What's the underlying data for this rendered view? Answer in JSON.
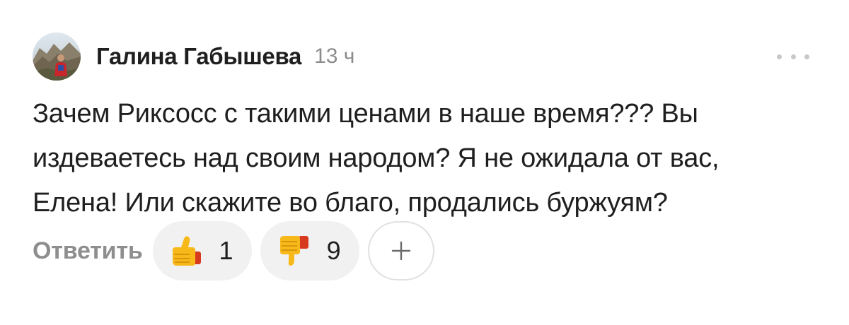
{
  "comment": {
    "author": "Галина Габышева",
    "time": "13 ч",
    "text": "Зачем Риксосс с такими ценами в наше время??? Вы издеваетесь над своим народом? Я не ожидала от вас, Елена! Или скажите во благо, продались буржуям?"
  },
  "actions": {
    "reply_label": "Ответить",
    "reactions": [
      {
        "icon": "thumbs-up-icon",
        "count": "1"
      },
      {
        "icon": "thumbs-down-icon",
        "count": "9"
      }
    ],
    "add_icon": "plus-icon"
  },
  "menu": {
    "icon": "more-dots-icon"
  }
}
